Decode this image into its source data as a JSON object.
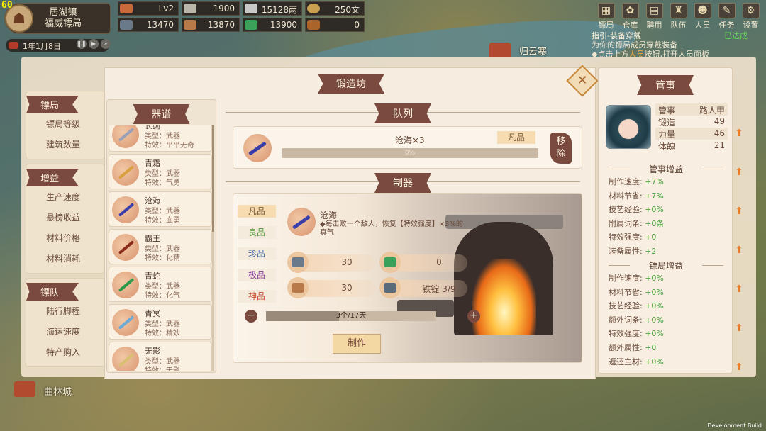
{
  "hud": {
    "fps": "60",
    "town": "居湖镇",
    "agency": "福威镖局",
    "date": "1年1月8日",
    "resources_row1": [
      {
        "icon": "level-icon",
        "value": "Lv2",
        "color": "#c86a3a"
      },
      {
        "icon": "scroll-icon",
        "value": "1900",
        "color": "#bab6aa"
      },
      {
        "icon": "silver-ingot-icon",
        "value": "15128两",
        "color": "#c8c8c8"
      },
      {
        "icon": "coin-icon",
        "value": "250文",
        "color": "#c8a050"
      }
    ],
    "resources_row2": [
      {
        "icon": "iron-ore-icon",
        "value": "13470",
        "color": "#6a7a8a"
      },
      {
        "icon": "wood-icon",
        "value": "13870",
        "color": "#b87a48"
      },
      {
        "icon": "herb-icon",
        "value": "13900",
        "color": "#3aa05a"
      },
      {
        "icon": "chest-icon",
        "value": "0",
        "color": "#a8642a"
      }
    ],
    "menu": [
      {
        "label": "镖局",
        "icon": "agency-icon",
        "glyph": "▦"
      },
      {
        "label": "仓库",
        "icon": "warehouse-icon",
        "glyph": "✿"
      },
      {
        "label": "聘用",
        "icon": "hire-icon",
        "glyph": "▤"
      },
      {
        "label": "队伍",
        "icon": "team-icon",
        "glyph": "♜"
      },
      {
        "label": "人员",
        "icon": "person-icon",
        "glyph": "☻"
      },
      {
        "label": "任务",
        "icon": "task-icon",
        "glyph": "✎"
      },
      {
        "label": "设置",
        "icon": "settings-icon",
        "glyph": "⚙"
      }
    ],
    "task": {
      "title": "指引-装备穿戴",
      "status": "已达成",
      "line1": "为你的镖局成员穿戴装备",
      "line2_pre": "◆点击上方",
      "line2_link": "人员",
      "line2_post": "按钮,打开人员面板"
    },
    "places": [
      "归云寨",
      "曲林城"
    ],
    "dev_build": "Development Build"
  },
  "left_stats": {
    "groups": [
      {
        "title": "镖局",
        "items": [
          "镖局等级",
          "建筑数量"
        ]
      },
      {
        "title": "增益",
        "items": [
          "生产速度",
          "悬榜收益",
          "材料价格",
          "材料消耗"
        ]
      },
      {
        "title": "镖队",
        "items": [
          "陆行脚程",
          "海运速度",
          "特产购入"
        ]
      }
    ]
  },
  "forge": {
    "title": "锻造坊",
    "close_icon": "close-icon",
    "recipe_header": "器谱",
    "type_label": "类型：",
    "effect_label": "特效：",
    "recipes": [
      {
        "name": "长剑",
        "type": "武器",
        "effect": "平平无奇",
        "color": "#9aa0b8"
      },
      {
        "name": "青霜",
        "type": "武器",
        "effect": "气勇",
        "color": "#d8a040"
      },
      {
        "name": "沧海",
        "type": "武器",
        "effect": "血勇",
        "color": "#3a3ea8"
      },
      {
        "name": "霸王",
        "type": "武器",
        "effect": "化精",
        "color": "#8a2a1a"
      },
      {
        "name": "青蛇",
        "type": "武器",
        "effect": "化气",
        "color": "#2a9a4a"
      },
      {
        "name": "青冥",
        "type": "武器",
        "effect": "精妙",
        "color": "#6aaad8"
      },
      {
        "name": "无影",
        "type": "武器",
        "effect": "无影",
        "color": "#d8c070"
      }
    ],
    "queue": {
      "header": "队列",
      "item": "沧海×3",
      "grade": "凡品",
      "progress": "0%",
      "progress_value": 0,
      "remove": "移除"
    },
    "craft": {
      "header": "制器",
      "grades": [
        "凡品",
        "良品",
        "珍品",
        "极品",
        "神品"
      ],
      "selected_grade": "凡品",
      "item_name": "沧海",
      "item_desc": "◆每击败一个敌人，恢复【特效强度】×3%的真气",
      "materials": [
        {
          "icon": "iron-ore-icon",
          "value": "30",
          "color": "#6a7a8a"
        },
        {
          "icon": "herb-icon",
          "value": "0",
          "color": "#3aa05a"
        },
        {
          "icon": "wood-icon",
          "value": "30",
          "color": "#b87a48"
        },
        {
          "icon": "iron-ingot-icon",
          "value": "铁锭 3/9",
          "color": "#5a6a7a"
        }
      ],
      "quantity": "3个/17天",
      "quantity_fraction": 0.43,
      "minus": "−",
      "plus": "+",
      "craft_button": "制作"
    }
  },
  "steward": {
    "title": "管事",
    "attrs": [
      {
        "k": "管事",
        "v": "路人甲"
      },
      {
        "k": "锻造",
        "v": "49"
      },
      {
        "k": "力量",
        "v": "46"
      },
      {
        "k": "体魄",
        "v": "21"
      }
    ],
    "steward_bonus_title": "管事增益",
    "steward_bonus": [
      {
        "k": "制作速度:",
        "v": "+7%"
      },
      {
        "k": "材料节省:",
        "v": "+7%"
      },
      {
        "k": "技艺经验:",
        "v": "+0%"
      },
      {
        "k": "附属词条:",
        "v": "+0条"
      },
      {
        "k": "特效强度:",
        "v": "+0"
      },
      {
        "k": "装备属性:",
        "v": "+2"
      }
    ],
    "agency_bonus_title": "镖局增益",
    "agency_bonus": [
      {
        "k": "制作速度:",
        "v": "+0%"
      },
      {
        "k": "材料节省:",
        "v": "+0%"
      },
      {
        "k": "技艺经验:",
        "v": "+0%"
      },
      {
        "k": "额外词条:",
        "v": "+0%"
      },
      {
        "k": "特效强度:",
        "v": "+0%"
      },
      {
        "k": "额外属性:",
        "v": "+0"
      },
      {
        "k": "返还主材:",
        "v": "+0%"
      }
    ]
  }
}
